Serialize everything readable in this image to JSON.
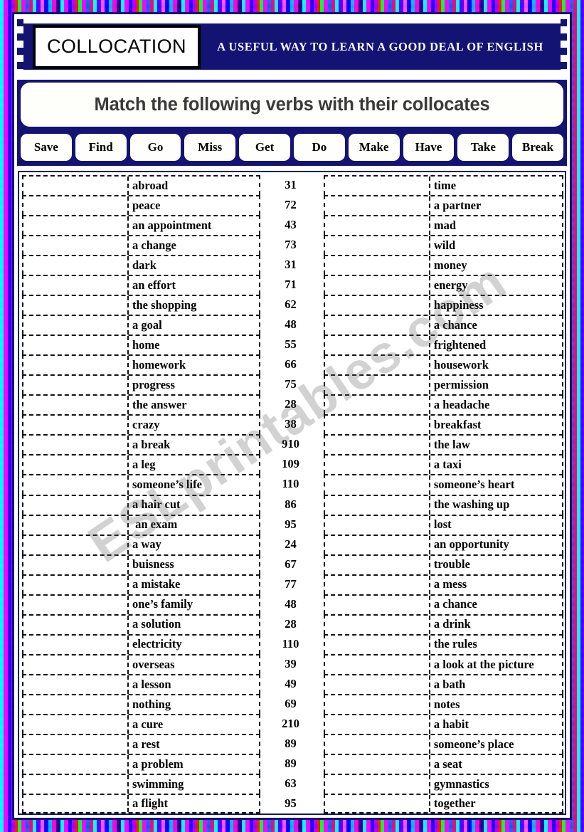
{
  "header": {
    "title": "COLLOCATION",
    "subtitle": "A USEFUL WAY TO LEARN A GOOD DEAL OF ENGLISH"
  },
  "instruction": "Match the following verbs with their collocates",
  "verbs": [
    "Save",
    "Find",
    "Go",
    "Miss",
    "Get",
    "Do",
    "Make",
    "Have",
    "Take",
    "Break"
  ],
  "watermark": "ESLprintables.com",
  "colors": {
    "navy": "#131374",
    "frame_border": "#14146e",
    "paper": "#ffffff",
    "instruction_text": "#3a3a3a"
  },
  "left_column": [
    {
      "collocate": "abroad",
      "number": "31"
    },
    {
      "collocate": "peace",
      "number": "72"
    },
    {
      "collocate": "an appointment",
      "number": "43"
    },
    {
      "collocate": "a change",
      "number": "73"
    },
    {
      "collocate": "dark",
      "number": "31"
    },
    {
      "collocate": "an effort",
      "number": "71"
    },
    {
      "collocate": "the shopping",
      "number": "62"
    },
    {
      "collocate": "a goal",
      "number": "48"
    },
    {
      "collocate": "home",
      "number": "55"
    },
    {
      "collocate": "homework",
      "number": "66"
    },
    {
      "collocate": "progress",
      "number": "75"
    },
    {
      "collocate": "the answer",
      "number": "28"
    },
    {
      "collocate": "crazy",
      "number": "38"
    },
    {
      "collocate": "a break",
      "number": "910"
    },
    {
      "collocate": "a leg",
      "number": "109"
    },
    {
      "collocate": "someone’s life",
      "number": "110"
    },
    {
      "collocate": "a hair cut",
      "number": "86"
    },
    {
      "collocate": " an exam",
      "number": "95"
    },
    {
      "collocate": "a way",
      "number": "24"
    },
    {
      "collocate": "buisness",
      "number": "67"
    },
    {
      "collocate": "a mistake",
      "number": "77"
    },
    {
      "collocate": "one’s family",
      "number": "48"
    },
    {
      "collocate": "a solution",
      "number": "28"
    },
    {
      "collocate": "electricity",
      "number": "110"
    },
    {
      "collocate": "overseas",
      "number": "39"
    },
    {
      "collocate": "a lesson",
      "number": "49"
    },
    {
      "collocate": "nothing",
      "number": "69"
    },
    {
      "collocate": "a cure",
      "number": "210"
    },
    {
      "collocate": "a rest",
      "number": "89"
    },
    {
      "collocate": "a problem",
      "number": "89"
    },
    {
      "collocate": "swimming",
      "number": "63"
    },
    {
      "collocate": "a flight",
      "number": "95"
    }
  ],
  "right_column": [
    {
      "collocate": "time"
    },
    {
      "collocate": "a partner"
    },
    {
      "collocate": "mad"
    },
    {
      "collocate": "wild"
    },
    {
      "collocate": "money"
    },
    {
      "collocate": "energy"
    },
    {
      "collocate": "happiness"
    },
    {
      "collocate": "a chance"
    },
    {
      "collocate": "frightened"
    },
    {
      "collocate": "housework"
    },
    {
      "collocate": "permission"
    },
    {
      "collocate": "a headache"
    },
    {
      "collocate": "breakfast"
    },
    {
      "collocate": "the law"
    },
    {
      "collocate": "a taxi"
    },
    {
      "collocate": "someone’s heart"
    },
    {
      "collocate": "the washing up"
    },
    {
      "collocate": "lost"
    },
    {
      "collocate": "an opportunity"
    },
    {
      "collocate": "trouble"
    },
    {
      "collocate": "a mess"
    },
    {
      "collocate": "a chance"
    },
    {
      "collocate": "a drink"
    },
    {
      "collocate": "the rules"
    },
    {
      "collocate": "a look at the picture"
    },
    {
      "collocate": "a bath"
    },
    {
      "collocate": "notes"
    },
    {
      "collocate": "a habit"
    },
    {
      "collocate": "someone’s place"
    },
    {
      "collocate": "a seat"
    },
    {
      "collocate": "gymnastics"
    },
    {
      "collocate": "together"
    }
  ]
}
